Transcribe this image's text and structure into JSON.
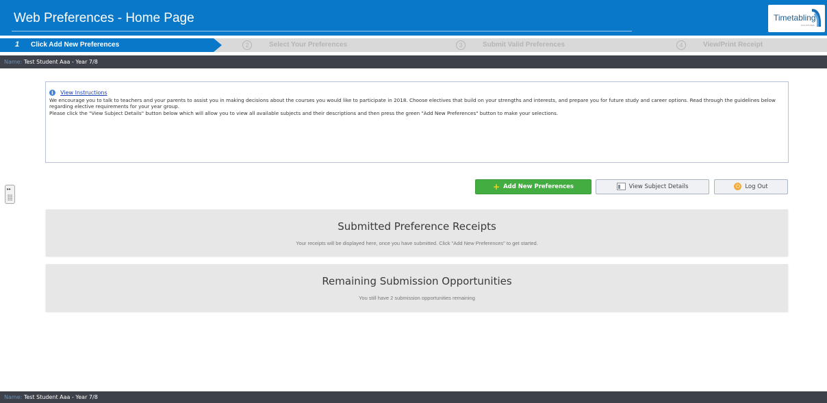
{
  "header": {
    "title": "Web Preferences - Home Page",
    "logo_text": "Timetabling",
    "logo_subtext": "SOLUTIONS"
  },
  "steps": [
    {
      "number": "1",
      "label": "Click Add New Preferences",
      "active": true
    },
    {
      "number": "2",
      "label": "Select Your Preferences",
      "active": false
    },
    {
      "number": "3",
      "label": "Submit Valid Preferences",
      "active": false
    },
    {
      "number": "4",
      "label": "View/Print Receipt",
      "active": false
    }
  ],
  "name_bar": {
    "label": "Name:",
    "value": "Test Student Aaa - Year 7/8"
  },
  "instructions": {
    "link_label": "View Instructions",
    "line1": "We encourage you to talk to teachers and your parents to assist you in making decisions about the courses you would like to participate in 2018.  Choose electives that build on your strengths and interests, and prepare you for future study and career options.  Read through the guidelines below regarding elective requirements for your year group.",
    "line2": "Please click the \"View Subject Details\" button below which will allow you to view all available subjects and their descriptions and then press the green \"Add New Preferences\" button to make your selections."
  },
  "buttons": {
    "add": "Add New Preferences",
    "view": "View Subject Details",
    "logout": "Log Out"
  },
  "receipts": {
    "title": "Submitted Preference Receipts",
    "subtitle": "Your receipts will be displayed here, once you have submitted. Click \"Add New Preferences\" to get started."
  },
  "remaining": {
    "title": "Remaining Submission Opportunities",
    "subtitle": "You still have 2 submission opportunities remaining"
  },
  "colors": {
    "header_blue": "#0a78c8",
    "dark_bar": "#3e4149",
    "add_green": "#44ad41"
  },
  "icons": [
    "info-icon",
    "plus-icon",
    "document-icon",
    "power-icon",
    "expand-arrows-icon"
  ]
}
